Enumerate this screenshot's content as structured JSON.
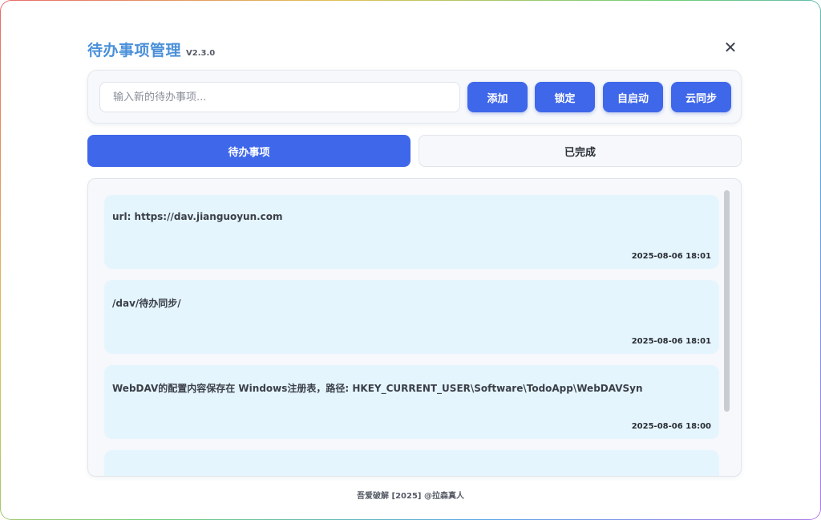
{
  "app": {
    "title": "待办事项管理",
    "version": "V2.3.0",
    "close_symbol": "✕"
  },
  "toolbar": {
    "input_placeholder": "输入新的待办事项...",
    "input_value": "",
    "add_label": "添加",
    "lock_label": "锁定",
    "autostart_label": "自启动",
    "cloud_sync_label": "云同步"
  },
  "tabs": [
    {
      "label": "待办事项",
      "active": true
    },
    {
      "label": "已完成",
      "active": false
    }
  ],
  "todos": [
    {
      "text": "url: https://dav.jianguoyun.com",
      "time": "2025-08-06 18:01"
    },
    {
      "text": "/dav/待办同步/",
      "time": "2025-08-06 18:01"
    },
    {
      "text": "WebDAV的配置内容保存在 Windows注册表，路径: HKEY_CURRENT_USER\\Software\\TodoApp\\WebDAVSyn",
      "time": "2025-08-06 18:00"
    },
    {
      "text": "",
      "time": ""
    }
  ],
  "footer": {
    "text": "吾爱破解 [2025] @拉森真人"
  },
  "colors": {
    "accent": "#3f67ea",
    "title": "#4a90d9",
    "item_bg": "#e5f5fd",
    "panel_bg": "#f6f8fb"
  }
}
